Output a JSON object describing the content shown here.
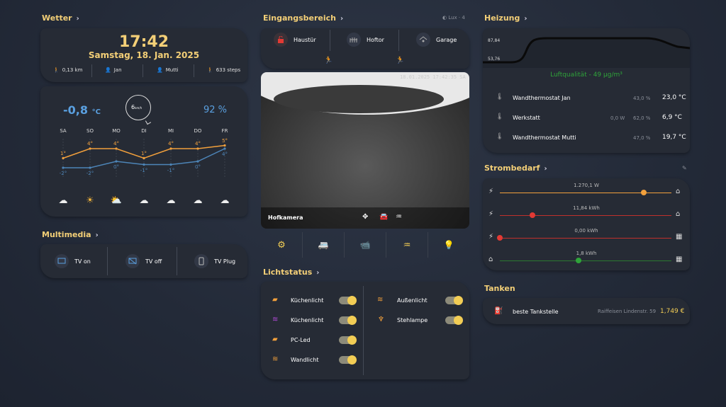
{
  "weather": {
    "title": "Wetter",
    "time": "17:42",
    "date": "Samstag, 18. Jan. 2025",
    "stats": [
      "0,13 km",
      "Jan",
      "Mutti",
      "633 steps"
    ],
    "temp": "-0,8",
    "temp_unit": "°C",
    "wind_speed": "6",
    "wind_unit": "km/h",
    "humidity": "92 %",
    "days": [
      "SA",
      "SO",
      "MO",
      "DI",
      "MI",
      "DO",
      "FR"
    ],
    "highs": [
      "1°",
      "4°",
      "4°",
      "1°",
      "4°",
      "4°",
      "5°"
    ],
    "lows": [
      "-2°",
      "-2°",
      "0°",
      "-1°",
      "-1°",
      "0°",
      "4°"
    ],
    "icons": [
      "cloud-icon",
      "sun-icon",
      "partly-cloudy-icon",
      "cloud-icon",
      "cloud-icon",
      "cloud-icon",
      "cloud-icon"
    ]
  },
  "multimedia": {
    "title": "Multimedia",
    "buttons": [
      "TV on",
      "TV off",
      "TV Plug"
    ]
  },
  "entrance": {
    "title": "Eingangsbereich",
    "lux": "Lux · 4",
    "doors": [
      "Haustür",
      "Hoftor",
      "Garage"
    ],
    "camera_label": "Hofkamera",
    "camera_timestamp": "18.01.2025 17:42:35 SA"
  },
  "lights": {
    "title": "Lichtstatus",
    "left": [
      "Küchenlicht",
      "Küchenlicht",
      "PC-Led",
      "Wandlicht"
    ],
    "right": [
      "Außenlicht",
      "Stehlampe"
    ]
  },
  "heating": {
    "title": "Heizung",
    "graph_max": "87,84",
    "graph_min": "53,76",
    "air_quality": "Luftqualität - 49 µg/m³",
    "rows": [
      {
        "name": "Wandthermostat Jan",
        "power": "",
        "humidity": "43,0 %",
        "temp": "23,0 °C"
      },
      {
        "name": "Werkstatt",
        "power": "0,0 W",
        "humidity": "62,0 %",
        "temp": "6,9 °C"
      },
      {
        "name": "Wandthermostat Mutti",
        "power": "",
        "humidity": "47,0 %",
        "temp": "19,7 °C"
      }
    ]
  },
  "power": {
    "title": "Strombedarf",
    "rows": [
      {
        "label": "1.270,1  W",
        "level": 0.84,
        "color": "#f2a03c",
        "dot": "#f2a03c"
      },
      {
        "label": "11,84  kWh",
        "level": 0.19,
        "color": "#c0302d",
        "dot": "#e23a34"
      },
      {
        "label": "0,00  kWh",
        "level": 0.0,
        "color": "#c0302d",
        "dot": "#e23a34"
      },
      {
        "label": "1,8  kWh",
        "level": 0.46,
        "color": "#2b7a2f",
        "dot": "#2fa33a"
      }
    ]
  },
  "fuel": {
    "title": "Tanken",
    "name": "beste Tankstelle",
    "location": "Raiffeisen Lindenstr. 59",
    "price": "1,749 €"
  },
  "colors": {
    "accent": "#f3cf77",
    "orange": "#f2a03c",
    "blue": "#5aa0e0",
    "green": "#2fa33a",
    "red": "#e23a34"
  }
}
